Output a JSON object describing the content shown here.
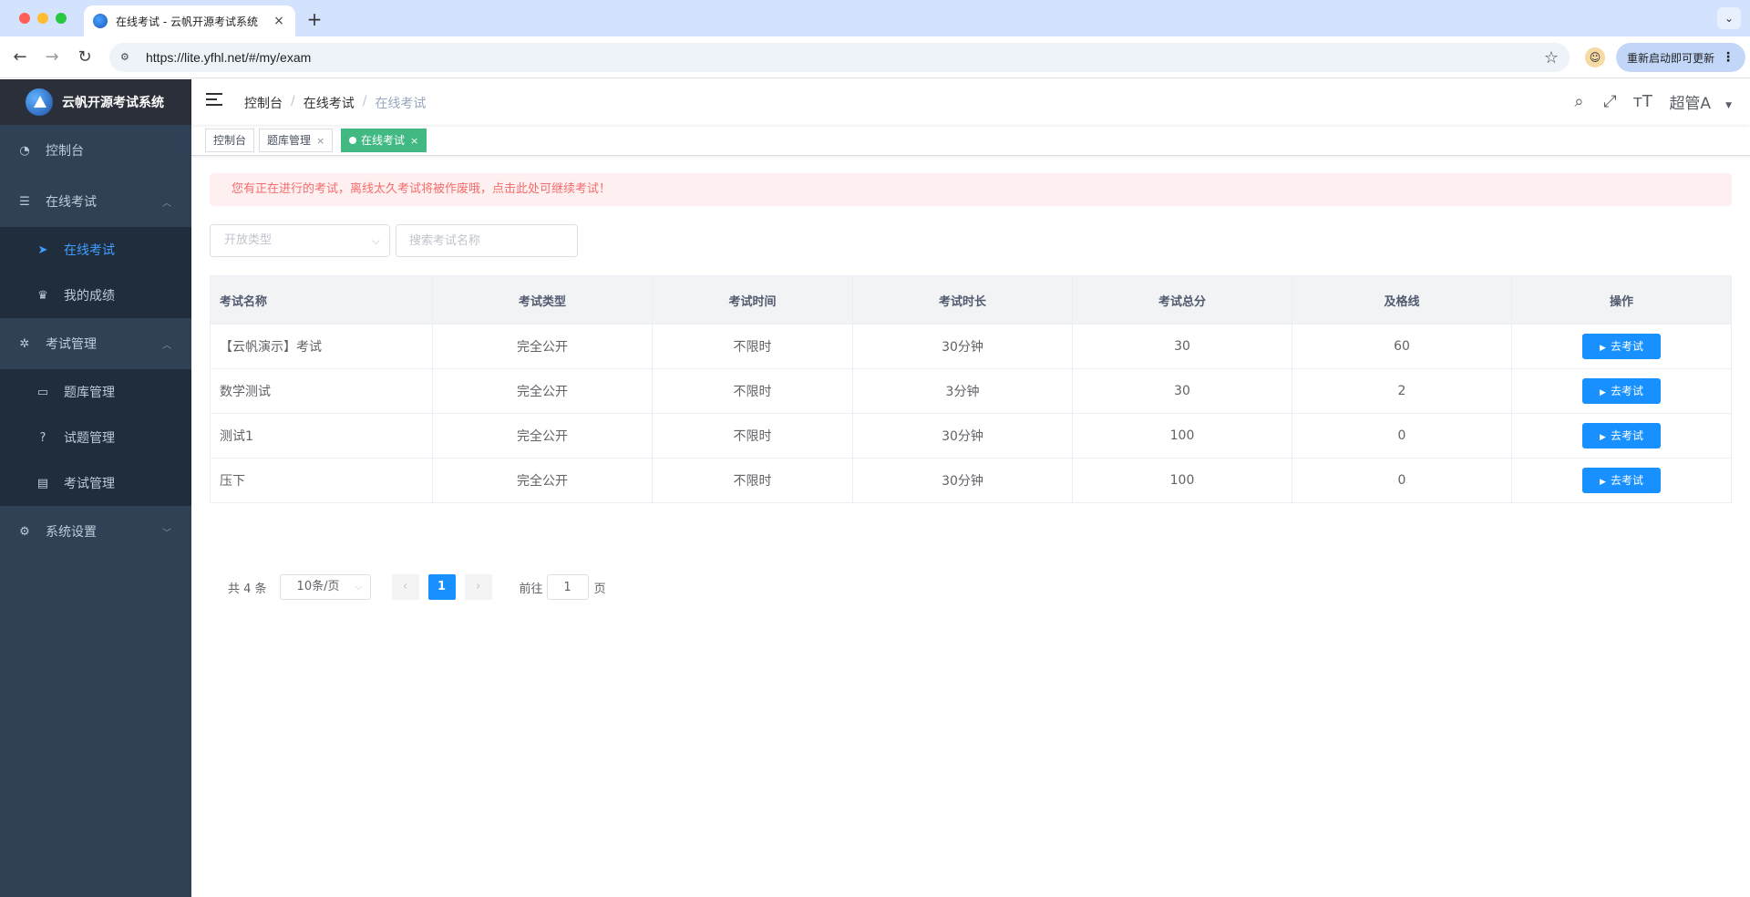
{
  "browser": {
    "tab_title": "在线考试 - 云帆开源考试系统",
    "tab_close": "×",
    "new_tab": "+",
    "url": "https://lite.yfhl.net/#/my/exam",
    "update_label": "重新启动即可更新"
  },
  "app": {
    "name": "云帆开源考试系统"
  },
  "sidebar": {
    "items": [
      {
        "label": "控制台",
        "icon": "dashboard-icon"
      },
      {
        "label": "在线考试",
        "icon": "list-icon",
        "expanded": true,
        "children": [
          {
            "label": "在线考试",
            "icon": "paper-plane-icon",
            "active": true
          },
          {
            "label": "我的成绩",
            "icon": "trophy-icon"
          }
        ]
      },
      {
        "label": "考试管理",
        "icon": "settings-cog-icon",
        "expanded": true,
        "children": [
          {
            "label": "题库管理",
            "icon": "monitor-icon"
          },
          {
            "label": "试题管理",
            "icon": "question-circle-icon"
          },
          {
            "label": "考试管理",
            "icon": "book-icon"
          }
        ]
      },
      {
        "label": "系统设置",
        "icon": "gear-icon",
        "expanded": false
      }
    ]
  },
  "navbar": {
    "breadcrumb": [
      "控制台",
      "在线考试",
      "在线考试"
    ],
    "user": "超管A"
  },
  "tags": [
    {
      "label": "控制台",
      "closable": false,
      "active": false
    },
    {
      "label": "题库管理",
      "closable": true,
      "active": false
    },
    {
      "label": "在线考试",
      "closable": true,
      "active": true
    }
  ],
  "alert": {
    "text": "您有正在进行的考试，离线太久考试将被作废哦，点击此处可继续考试！",
    "color": "#f56c6c"
  },
  "filters": {
    "type_placeholder": "开放类型",
    "search_placeholder": "搜索考试名称"
  },
  "table": {
    "headers": [
      "考试名称",
      "考试类型",
      "考试时间",
      "考试时长",
      "考试总分",
      "及格线",
      "操作"
    ],
    "action_label": "去考试",
    "rows": [
      [
        "【云帆演示】考试",
        "完全公开",
        "不限时",
        "30分钟",
        "30",
        "60"
      ],
      [
        "数学测试",
        "完全公开",
        "不限时",
        "3分钟",
        "30",
        "2"
      ],
      [
        "测试1",
        "完全公开",
        "不限时",
        "30分钟",
        "100",
        "0"
      ],
      [
        "压下",
        "完全公开",
        "不限时",
        "30分钟",
        "100",
        "0"
      ]
    ]
  },
  "pagination": {
    "total_label": "共 4 条",
    "page_size": "10条/页",
    "current_page": "1",
    "goto_prefix": "前往",
    "goto_value": "1",
    "goto_suffix": "页"
  },
  "colors": {
    "sidebar_bg": "#304156",
    "primary": "#1890ff",
    "active_tag": "#42b983"
  }
}
